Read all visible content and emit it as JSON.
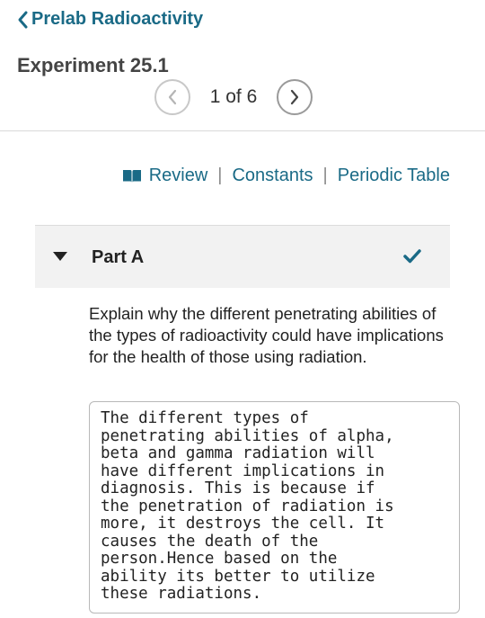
{
  "nav": {
    "back_label": "Prelab Radioactivity",
    "back_icon": "chevron-left-icon"
  },
  "header": {
    "title": "Experiment 25.1",
    "pager": {
      "text": "1 of 6",
      "prev_icon": "chevron-left-icon",
      "next_icon": "chevron-right-icon"
    }
  },
  "toolbar": {
    "review_label": "Review",
    "review_icon": "book-icon",
    "constants_label": "Constants",
    "periodic_label": "Periodic Table",
    "separator": "|"
  },
  "part": {
    "label": "Part A",
    "status_icon": "checkmark-icon",
    "toggle_icon": "caret-down-icon"
  },
  "question": {
    "text": "Explain why the different penetrating abilities of the types of radioactivity could have implications for the health of those using radiation."
  },
  "answer": {
    "value": "The different types of\npenetrating abilities of alpha,\nbeta and gamma radiation will\nhave different implications in\ndiagnosis. This is because if\nthe penetration of radiation is\nmore, it destroys the cell. It\ncauses the death of the\nperson.Hence based on the\nability its better to utilize\nthese radiations."
  },
  "colors": {
    "link": "#1a6a86",
    "check": "#1a6a86",
    "panel_bg": "#f2f2f2"
  }
}
